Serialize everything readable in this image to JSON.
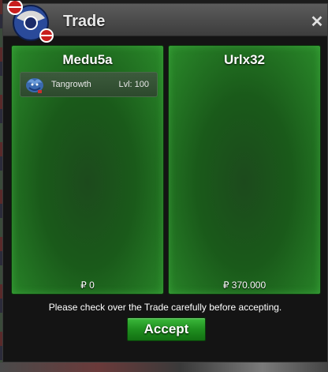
{
  "window": {
    "title": "Trade",
    "close_icon": "close-icon",
    "logo_icon": "pokeball-logo-icon"
  },
  "panels": [
    {
      "player": "Medu5a",
      "money": "₽ 0",
      "pokemon": [
        {
          "name": "Tangrowth",
          "level": "Lvl: 100",
          "icon": "tangrowth-sprite-icon"
        }
      ]
    },
    {
      "player": "Urlx32",
      "money": "₽ 370.000",
      "pokemon": []
    }
  ],
  "footer": {
    "notice": "Please check over the Trade carefully before accepting.",
    "accept_label": "Accept"
  },
  "colors": {
    "panel_green": "#1a5a1a",
    "accept_green": "#1f8f1f",
    "titlebar": "#4a4a4a"
  }
}
